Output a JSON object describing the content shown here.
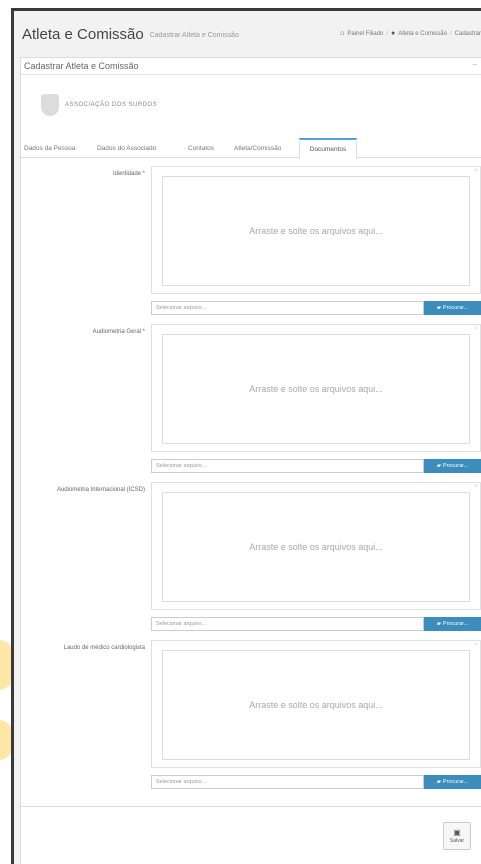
{
  "header": {
    "title": "Atleta e Comissão",
    "subtitle": "Cadastrar Atleta e Comissão"
  },
  "breadcrumb": {
    "items": [
      "Painel Filiado",
      "Atleta e Comissão",
      "Cadastrar"
    ]
  },
  "panel": {
    "title": "Cadastrar Atleta e Comissão",
    "association": "ASSOCIAÇÃO DOS SURDOS"
  },
  "tabs": [
    {
      "label": "Dados da Pessoa",
      "active": false
    },
    {
      "label": "Dados do Associado",
      "active": false
    },
    {
      "label": "Contatos",
      "active": false
    },
    {
      "label": "Atleta/Comissão",
      "active": false
    },
    {
      "label": "Documentos",
      "active": true
    }
  ],
  "documents": [
    {
      "label": "Identidade *",
      "drop_text": "Arraste e solte os arquivos aqui...",
      "placeholder": "Selecionar arquivo...",
      "button": "Procurar..."
    },
    {
      "label": "Audiometria Geral *",
      "drop_text": "Arraste e solte os arquivos aqui...",
      "placeholder": "Selecionar arquivo...",
      "button": "Procurar..."
    },
    {
      "label": "Audiometria Internacional (ICSD)",
      "drop_text": "Arraste e solte os arquivos aqui...",
      "placeholder": "Selecionar arquivo...",
      "button": "Procurar..."
    },
    {
      "label": "Laudo de médico cardiologista",
      "drop_text": "Arraste e solte os arquivos aqui...",
      "placeholder": "Selecionar arquivo...",
      "button": "Procurar..."
    }
  ],
  "footer": {
    "save_label": "Salvar"
  },
  "colors": {
    "accent": "#3c8dbc",
    "active_tab": "#4aa3df",
    "decoration": "#fdd35e"
  },
  "icons": {
    "home": "home-icon",
    "breadcrumb_module": "users-icon",
    "browse": "folder-open-icon",
    "save": "floppy-disk-icon",
    "collapse": "minus-icon"
  }
}
